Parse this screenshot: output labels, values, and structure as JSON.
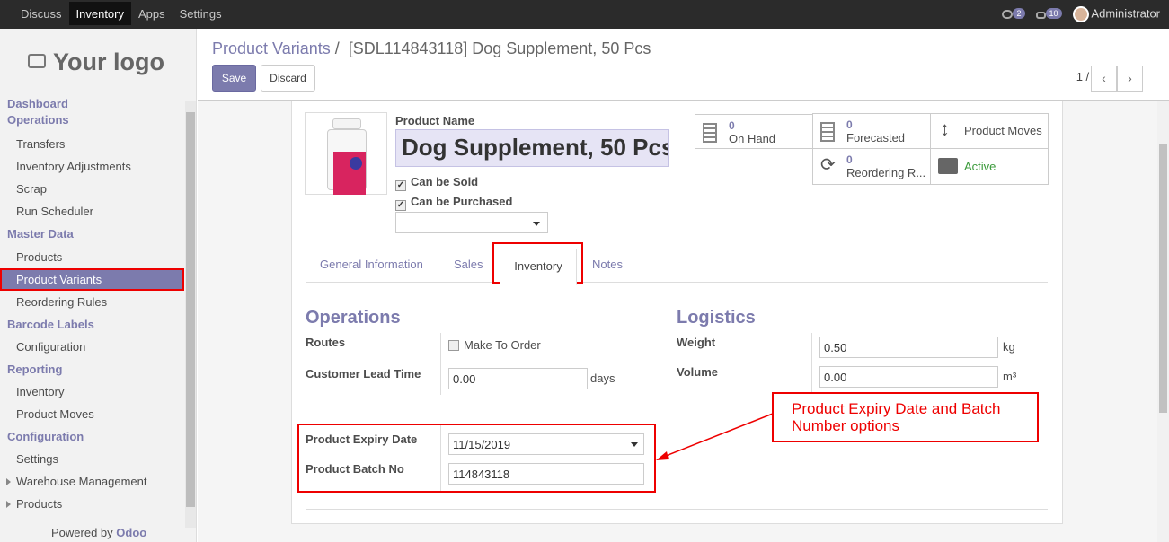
{
  "topbar": {
    "menu": [
      "Discuss",
      "Inventory",
      "Apps",
      "Settings"
    ],
    "active_menu": "Inventory",
    "chat_count": "2",
    "activity_count": "10",
    "user": "Administrator"
  },
  "sidebar": {
    "logo_text": "Your logo",
    "sections": [
      {
        "title": "Dashboard Operations",
        "items": [
          "Transfers",
          "Inventory Adjustments",
          "Scrap",
          "Run Scheduler"
        ]
      },
      {
        "title": "Master Data",
        "items": [
          "Products",
          "Product Variants",
          "Reordering Rules"
        ]
      },
      {
        "title": "Barcode Labels",
        "items": [
          "Configuration"
        ]
      },
      {
        "title": "Reporting",
        "items": [
          "Inventory",
          "Product Moves"
        ]
      },
      {
        "title": "Configuration",
        "items": [
          "Settings",
          "Warehouse Management",
          "Products"
        ]
      }
    ],
    "selected_item": "Product Variants",
    "powered_by": "Powered by",
    "powered_brand": "Odoo"
  },
  "header": {
    "breadcrumb_link": "Product Variants",
    "breadcrumb_sep": "/",
    "breadcrumb_current": "[SDL114843118] Dog Supplement, 50 Pcs",
    "save_label": "Save",
    "discard_label": "Discard",
    "pager": "1 / 1"
  },
  "form": {
    "product_name_label": "Product Name",
    "product_name": "Dog Supplement, 50 Pcs",
    "can_be_sold": "Can be Sold",
    "can_be_purchased": "Can be Purchased",
    "stats": {
      "on_hand_value": "0",
      "on_hand_label": "On Hand",
      "forecasted_value": "0",
      "forecasted_label": "Forecasted",
      "product_moves_label": "Product Moves",
      "reordering_value": "0",
      "reordering_label": "Reordering R...",
      "active_label": "Active"
    },
    "tabs": [
      "General Information",
      "Sales",
      "Inventory",
      "Notes"
    ],
    "active_tab": "Inventory",
    "operations": {
      "title": "Operations",
      "routes_label": "Routes",
      "make_to_order": "Make To Order",
      "lead_time_label": "Customer Lead Time",
      "lead_time_value": "0.00",
      "lead_time_unit": "days",
      "expiry_label": "Product Expiry Date",
      "expiry_value": "11/15/2019",
      "batch_label": "Product Batch No",
      "batch_value": "114843118"
    },
    "logistics": {
      "title": "Logistics",
      "weight_label": "Weight",
      "weight_value": "0.50",
      "weight_unit": "kg",
      "volume_label": "Volume",
      "volume_value": "0.00",
      "volume_unit": "m³"
    }
  },
  "annotation": {
    "callout_text": "Product Expiry Date and Batch Number options"
  },
  "colors": {
    "brand": "#7c7bad",
    "highlight": "#ee0000"
  }
}
